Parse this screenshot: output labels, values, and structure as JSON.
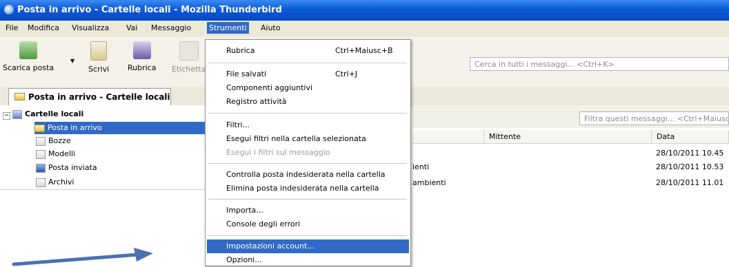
{
  "window": {
    "title": "Posta in arrivo - Cartelle locali - Mozilla Thunderbird"
  },
  "menu": {
    "file": "File",
    "modifica": "Modifica",
    "visualizza": "Visualizza",
    "vai": "Vai",
    "messaggio": "Messaggio",
    "strumenti": "Strumenti",
    "aiuto": "Aiuto"
  },
  "toolbar": {
    "get_mail": "Scarica posta",
    "write": "Scrivi",
    "address_book": "Rubrica",
    "tag": "Etichetta",
    "search_placeholder": "Cerca in tutti i messaggi... <Ctrl+K>"
  },
  "tab": {
    "label": "Posta in arrivo - Cartelle locali"
  },
  "folders": {
    "root": "Cartelle locali",
    "items": [
      "Posta in arrivo",
      "Bozze",
      "Modelli",
      "Posta inviata",
      "Archivi"
    ]
  },
  "message_list": {
    "filter_placeholder": "Filtra questi messaggi... <Ctrl+Maiusc",
    "columns": {
      "sender": "Mittente",
      "date": "Data"
    },
    "rows": [
      {
        "subject_fragment": "",
        "date": "28/10/2011 10.45"
      },
      {
        "subject_fragment": "ienti",
        "date": "28/10/2011 10.53"
      },
      {
        "subject_fragment": "ambienti",
        "date": "28/10/2011 11.01"
      }
    ]
  },
  "strumenti_menu": {
    "rubrica": "Rubrica",
    "rubrica_sc": "Ctrl+Maiusc+B",
    "file_salvati": "File salvati",
    "file_salvati_sc": "Ctrl+J",
    "componenti": "Componenti aggiuntivi",
    "registro": "Registro attività",
    "filtri": "Filtri...",
    "esegui_cartella": "Esegui filtri nella cartella selezionata",
    "esegui_messaggio": "Esegui i filtri sul messaggio",
    "controlla": "Controlla posta indesiderata nella cartella",
    "elimina": "Elimina posta indesiderata nella cartella",
    "importa": "Importa...",
    "console": "Console degli errori",
    "impostazioni": "Impostazioni account...",
    "opzioni": "Opzioni..."
  },
  "colors": {
    "title_blue": "#0a5ad8",
    "highlight": "#316ac5",
    "annotation_arrow": "#4a72b2"
  }
}
